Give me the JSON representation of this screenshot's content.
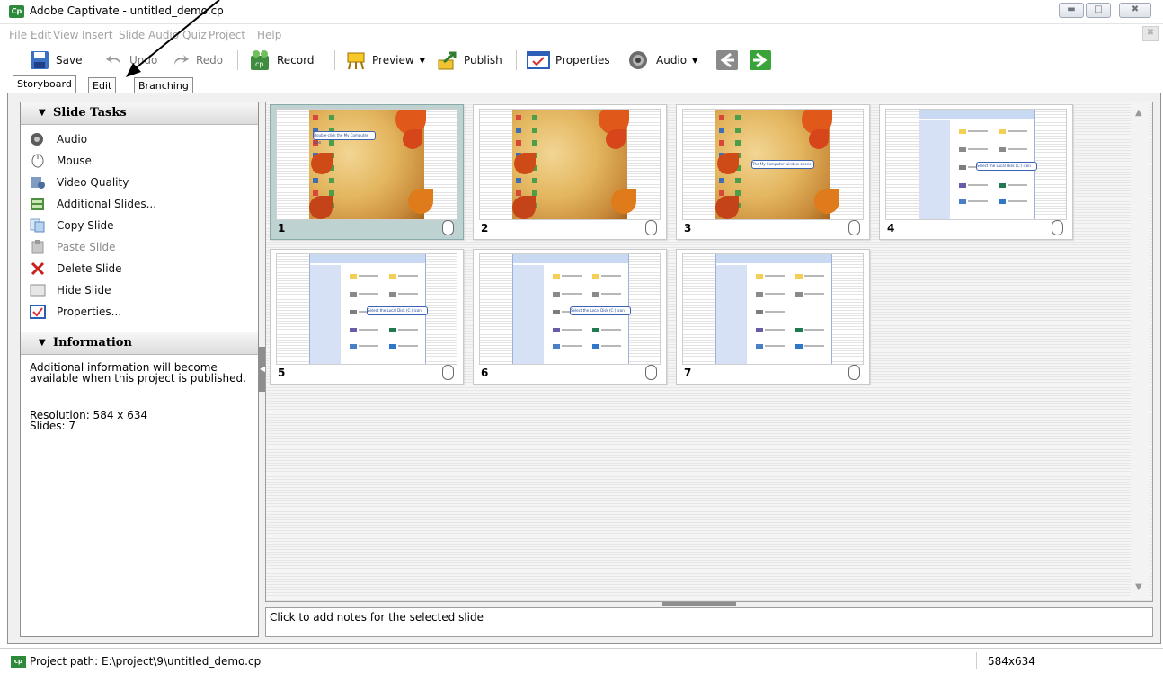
{
  "window": {
    "title": "Adobe Captivate - untitled_demo.cp",
    "app_icon": "Cp"
  },
  "menu": [
    "File",
    "Edit",
    "View",
    "Insert",
    "Slide",
    "Audio",
    "Quiz",
    "Project",
    "Help"
  ],
  "toolbar": {
    "save": "Save",
    "undo": "Undo",
    "redo": "Redo",
    "record": "Record",
    "preview": "Preview",
    "publish": "Publish",
    "properties": "Properties",
    "audio": "Audio"
  },
  "tabs": [
    "Storyboard",
    "Edit",
    "Branching"
  ],
  "slide_tasks": {
    "heading": "Slide Tasks",
    "items": [
      {
        "label": "Audio",
        "icon": "speaker-icon",
        "enabled": true
      },
      {
        "label": "Mouse",
        "icon": "mouse-icon",
        "enabled": true
      },
      {
        "label": "Video Quality",
        "icon": "video-quality-icon",
        "enabled": true
      },
      {
        "label": "Additional Slides...",
        "icon": "additional-slides-icon",
        "enabled": true
      },
      {
        "label": "Copy Slide",
        "icon": "copy-icon",
        "enabled": true
      },
      {
        "label": "Paste Slide",
        "icon": "paste-icon",
        "enabled": false
      },
      {
        "label": "Delete Slide",
        "icon": "delete-icon",
        "enabled": true
      },
      {
        "label": "Hide Slide",
        "icon": "hide-slide-icon",
        "enabled": true
      },
      {
        "label": "Properties...",
        "icon": "properties-icon",
        "enabled": true
      }
    ]
  },
  "information": {
    "heading": "Information",
    "text": "Additional information will become available when this project is published.",
    "resolution": "Resolution: 584 x 634",
    "slides": "Slides: 7"
  },
  "slides": [
    {
      "number": "1",
      "kind": "autumn",
      "selected": true,
      "callout": "Double-click the My Computer icon"
    },
    {
      "number": "2",
      "kind": "autumn",
      "selected": false,
      "callout": ""
    },
    {
      "number": "3",
      "kind": "autumn",
      "selected": false,
      "callout": "The My Computer window opens"
    },
    {
      "number": "4",
      "kind": "explorer",
      "selected": false,
      "callout": "Select the Local Disk (C:) icon"
    },
    {
      "number": "5",
      "kind": "explorer",
      "selected": false,
      "callout": "Select the Local Disk (C:) icon"
    },
    {
      "number": "6",
      "kind": "explorer",
      "selected": false,
      "callout": "Select the Local Disk (C:) icon"
    },
    {
      "number": "7",
      "kind": "explorer",
      "selected": false,
      "callout": ""
    }
  ],
  "notes": {
    "placeholder": "Click to add notes for the selected slide"
  },
  "status": {
    "path": "Project path: E:\\project\\9\\untitled_demo.cp",
    "resolution": "584x634"
  }
}
